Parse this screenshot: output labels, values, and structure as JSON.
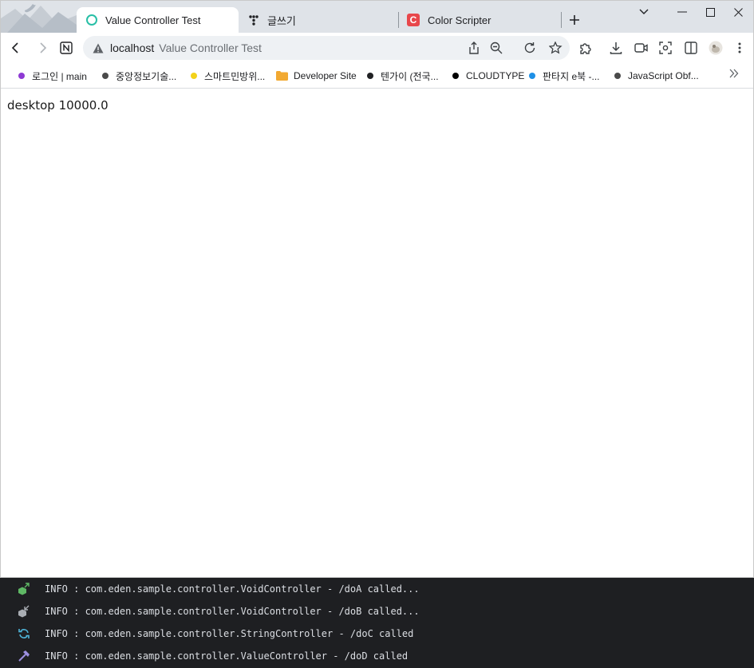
{
  "browser": {
    "tabs": [
      {
        "title": "Value Controller Test",
        "icon": "ring-favicon-icon",
        "active": true
      },
      {
        "title": "글쓰기",
        "icon": "dots-favicon-icon",
        "active": false
      },
      {
        "title": "Color Scripter",
        "icon": "color-scripter-favicon-icon",
        "favicon_letter": "C",
        "active": false
      }
    ],
    "address": {
      "host": "localhost",
      "page_title": "Value Controller Test"
    },
    "bookmarks": [
      {
        "label": "로그인 | main",
        "dot_color": "#8e3ad4"
      },
      {
        "label": "중앙정보기술...",
        "dot_color": "#4a4a4a"
      },
      {
        "label": "스마트민방위...",
        "dot_color": "#f3d21a"
      },
      {
        "label": "Developer Site",
        "icon": "folder-icon",
        "dot_color": "#f2a931"
      },
      {
        "label": "텐가이 (전국...",
        "dot_color": "#202124"
      },
      {
        "label": "CLOUDTYPE",
        "dot_color": "#000000"
      },
      {
        "label": "판타지 e북 -...",
        "dot_color": "#1e90e6"
      },
      {
        "label": "JavaScript Obf...",
        "dot_color": "#4a4a4a"
      }
    ]
  },
  "page": {
    "text": "desktop 10000.0"
  },
  "console": {
    "lines": [
      {
        "icon": "green-cube-arrow-icon",
        "text": "INFO : com.eden.sample.controller.VoidController - /doA called..."
      },
      {
        "icon": "grey-cube-arrow-icon",
        "text": "INFO : com.eden.sample.controller.VoidController - /doB called..."
      },
      {
        "icon": "reload-icon",
        "text": "INFO : com.eden.sample.controller.StringController - /doC called"
      },
      {
        "icon": "hammer-icon",
        "text": "INFO : com.eden.sample.controller.ValueController - /doD called"
      }
    ]
  },
  "colors": {
    "tabstrip": "#dfe3e8",
    "omnibox": "#eef1f4",
    "console_bg": "#1e1f22",
    "console_text": "#dcdfe4"
  }
}
